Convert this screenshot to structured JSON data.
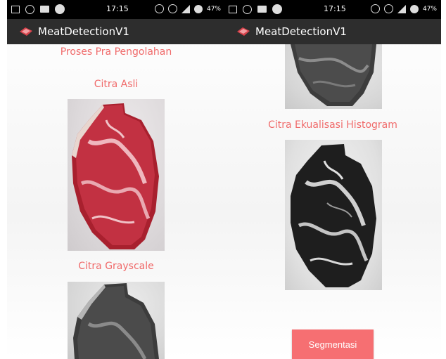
{
  "statusbar": {
    "time": "17:15",
    "battery": "47%"
  },
  "app": {
    "title": "MeatDetectionV1"
  },
  "left": {
    "heading": "Proses Pra Pengolahan",
    "label_original": "Citra Asli",
    "label_grayscale": "Citra Grayscale"
  },
  "right": {
    "label_equalized": "Citra Ekualisasi Histogram",
    "button_label": "Segmentasi"
  },
  "colors": {
    "label_text": "#f06a6a",
    "button_bg": "#f66f72",
    "appbar_bg": "#2d2d2d",
    "statusbar_bg": "#000000"
  },
  "icons": [
    "image-icon",
    "hotspot-icon",
    "message-icon",
    "sync-icon",
    "nfc-icon",
    "alarm-icon",
    "signal-icon",
    "battery-icon",
    "meat-icon"
  ]
}
